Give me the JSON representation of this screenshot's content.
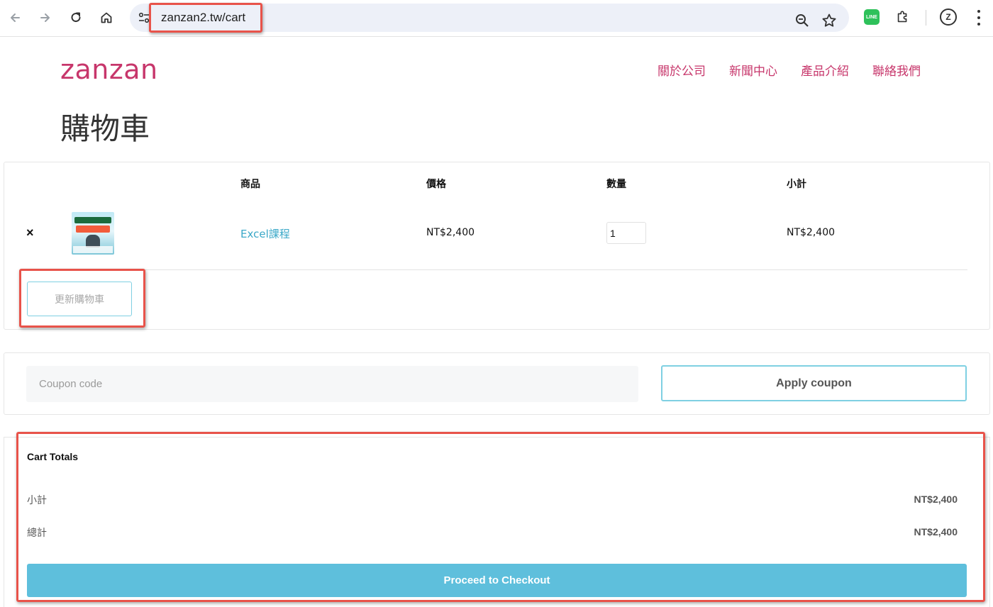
{
  "browser": {
    "url": "zanzan2.tw/cart",
    "extension_line_label": "LINE",
    "profile_initial": "Z"
  },
  "site": {
    "logo": "zanzan",
    "brand_color": "#c7366b",
    "nav": [
      "關於公司",
      "新聞中心",
      "產品介紹",
      "聯絡我們"
    ]
  },
  "page": {
    "title": "購物車"
  },
  "cart": {
    "headers": {
      "product": "商品",
      "price": "價格",
      "quantity": "數量",
      "subtotal": "小計"
    },
    "remove_symbol": "×",
    "items": [
      {
        "name": "Excel課程",
        "price": "NT$2,400",
        "quantity": "1",
        "subtotal": "NT$2,400",
        "thumbnail_icon": "excel-course-thumbnail"
      }
    ],
    "update_button": "更新購物車"
  },
  "coupon": {
    "placeholder": "Coupon code",
    "apply_button": "Apply coupon"
  },
  "totals": {
    "title": "Cart Totals",
    "subtotal_label": "小計",
    "subtotal_value": "NT$2,400",
    "total_label": "總計",
    "total_value": "NT$2,400",
    "checkout_button": "Proceed to Checkout"
  },
  "colors": {
    "accent": "#5ebfdc",
    "link": "#3aa8c8",
    "highlight_annotation": "#e8534a"
  }
}
